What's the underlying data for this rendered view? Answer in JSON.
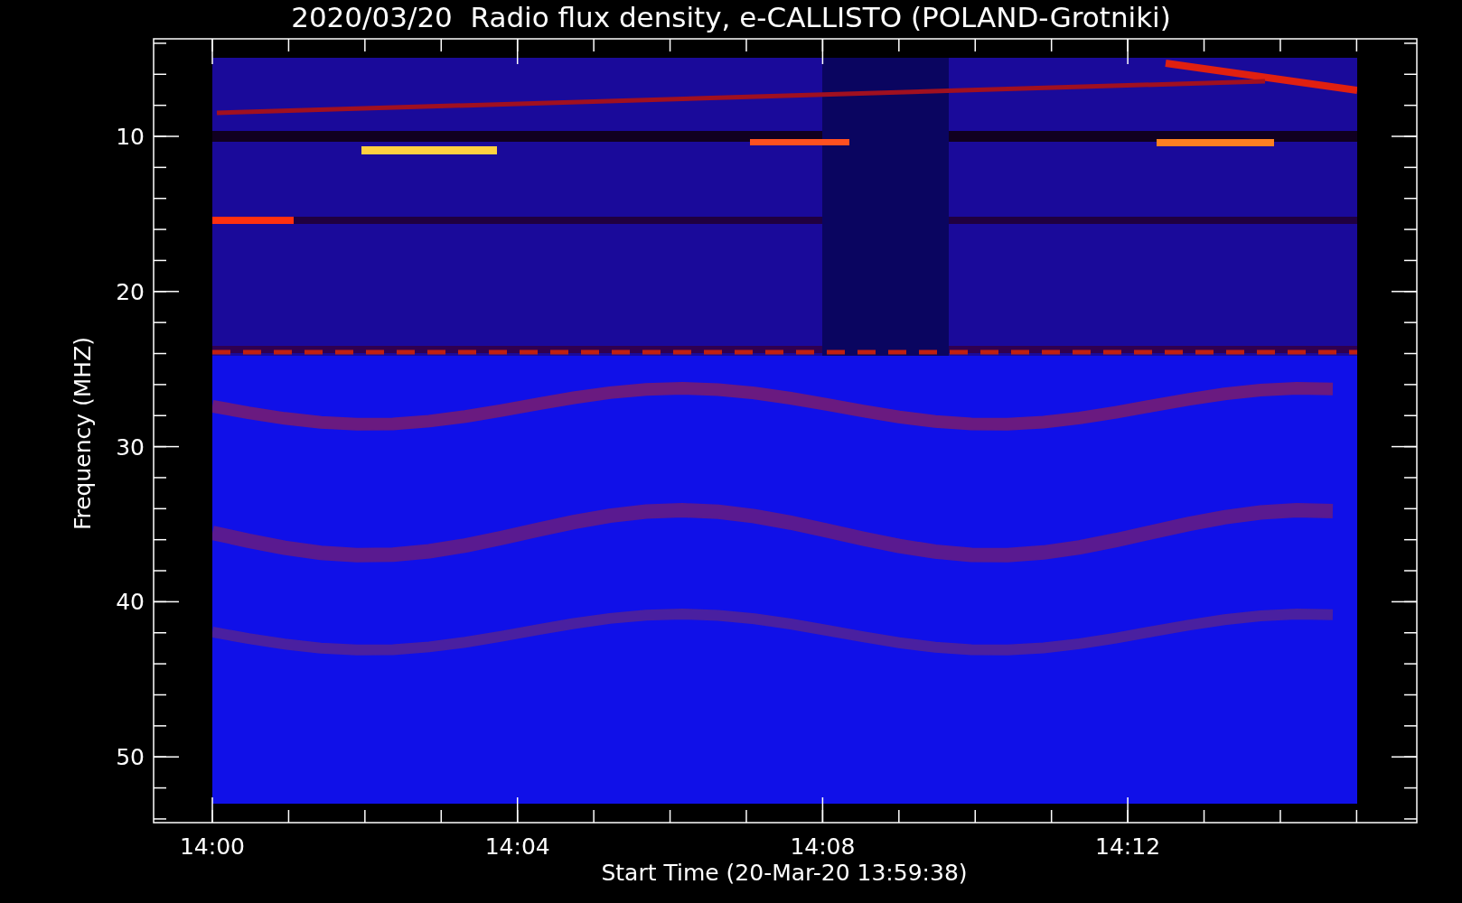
{
  "title": "2020/03/20  Radio flux density, e-CALLISTO (POLAND-Grotniki)",
  "y_axis": {
    "label": "Frequency (MHZ)",
    "ticks": [
      "10",
      "20",
      "30",
      "40",
      "50"
    ]
  },
  "x_axis": {
    "label": "Start Time (20-Mar-20 13:59:38)",
    "ticks": [
      "14:00",
      "14:04",
      "14:08",
      "14:12"
    ]
  }
}
